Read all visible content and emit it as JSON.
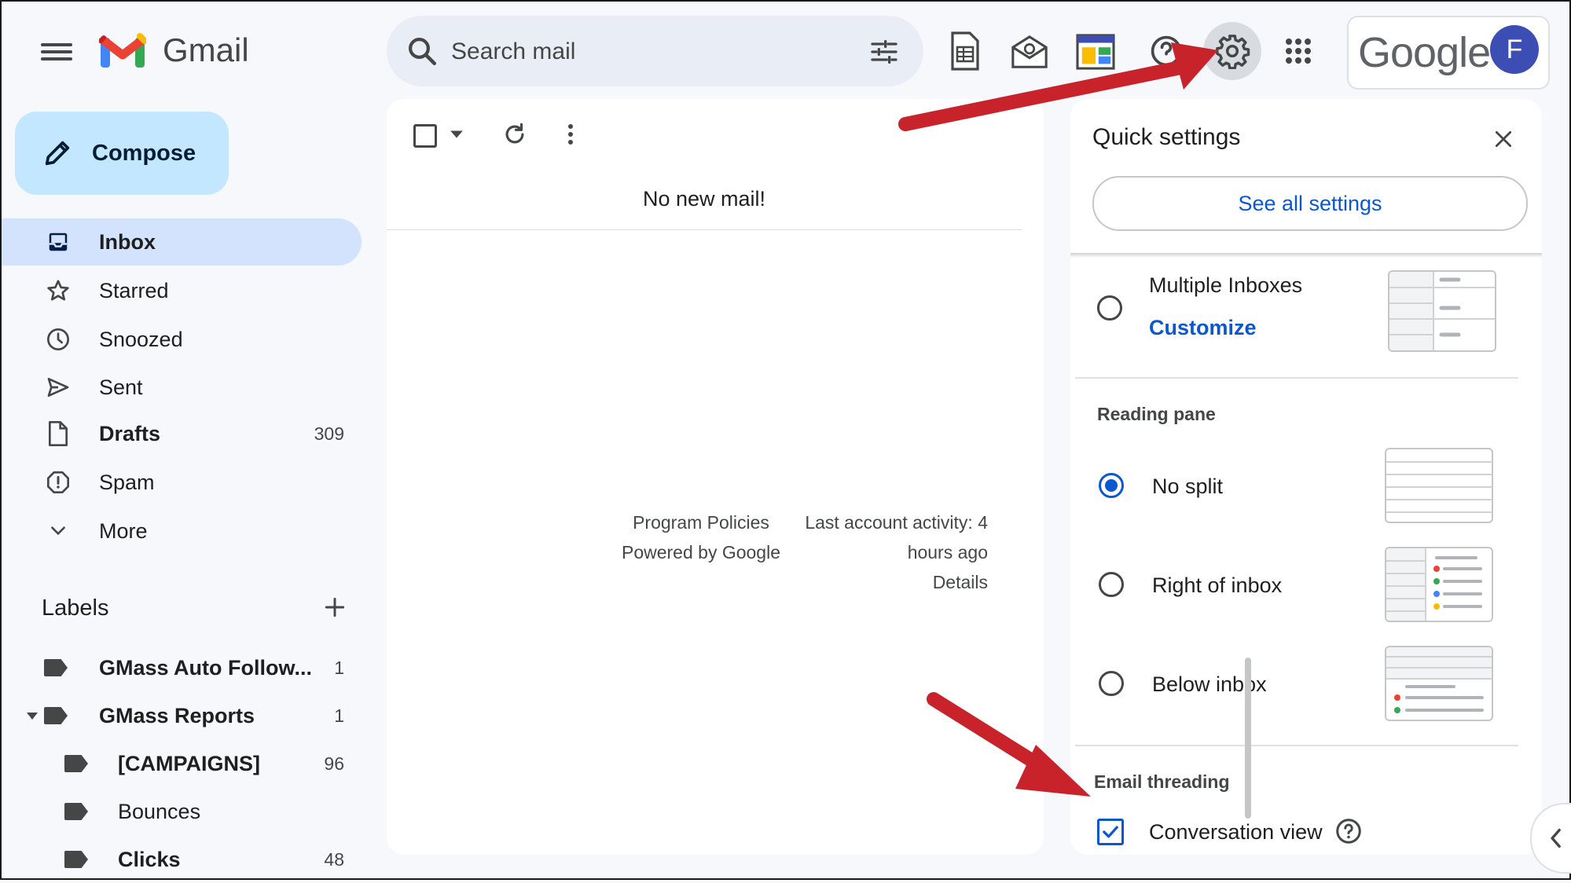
{
  "header": {
    "app_name": "Gmail",
    "search_placeholder": "Search mail",
    "google_word": "Google",
    "avatar_letter": "F"
  },
  "compose": {
    "label": "Compose"
  },
  "nav": [
    {
      "label": "Inbox",
      "count": "",
      "bold": true,
      "active": true,
      "icon": "inbox-icon"
    },
    {
      "label": "Starred",
      "count": "",
      "icon": "star-icon"
    },
    {
      "label": "Snoozed",
      "count": "",
      "icon": "clock-icon"
    },
    {
      "label": "Sent",
      "count": "",
      "icon": "send-icon"
    },
    {
      "label": "Drafts",
      "count": "309",
      "bold": true,
      "icon": "draft-icon"
    },
    {
      "label": "Spam",
      "count": "",
      "icon": "spam-icon"
    },
    {
      "label": "More",
      "count": "",
      "icon": "chevron-down-icon"
    }
  ],
  "labels": {
    "title": "Labels",
    "items": [
      {
        "label": "GMass Auto Follow...",
        "count": "1",
        "bold": true
      },
      {
        "label": "GMass Reports",
        "count": "1",
        "bold": true
      },
      {
        "label": "[CAMPAIGNS]",
        "count": "96",
        "bold": true
      },
      {
        "label": "Bounces",
        "count": ""
      },
      {
        "label": "Clicks",
        "count": "48",
        "bold": true
      }
    ]
  },
  "main": {
    "empty_message": "No new mail!",
    "footer_policies": "Program Policies",
    "footer_powered": "Powered by Google",
    "activity_line1": "Last account activity: 4",
    "activity_line2": "hours ago",
    "details": "Details"
  },
  "quick_settings": {
    "title": "Quick settings",
    "see_all": "See all settings",
    "multiple_inboxes": "Multiple Inboxes",
    "customize": "Customize",
    "reading_pane": {
      "heading": "Reading pane",
      "options": [
        {
          "label": "No split",
          "selected": true
        },
        {
          "label": "Right of inbox",
          "selected": false
        },
        {
          "label": "Below inbox",
          "selected": false
        }
      ]
    },
    "threading": {
      "heading": "Email threading",
      "conversation_view": "Conversation view",
      "checked": true
    }
  },
  "colors": {
    "accent": "#0b57d0",
    "compose_bg": "#c2e7ff",
    "active_nav": "#d3e3fd",
    "arrow": "#c8222a",
    "avatar": "#3c4eb4"
  }
}
